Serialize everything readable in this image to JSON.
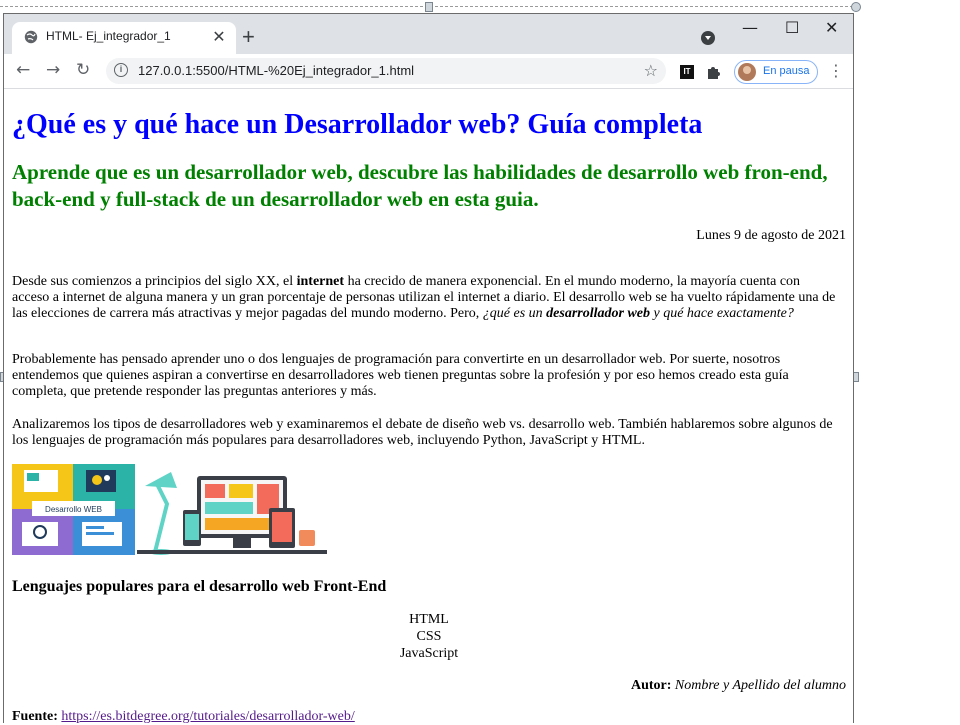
{
  "browser": {
    "tab_title": "HTML- Ej_integrador_1",
    "url": "127.0.0.1:5500/HTML-%20Ej_integrador_1.html",
    "profile_label": "En pausa"
  },
  "page": {
    "title": "¿Qué es y qué hace un Desarrollador web? Guía completa",
    "subtitle": "Aprende que es un desarrollador web, descubre las habilidades de desarrollo web fron-end, back-end y full-stack de un desarrollador web en esta guia.",
    "date": "Lunes 9 de agosto de 2021",
    "p1": {
      "t1": "Desde sus comienzos a principios del siglo XX, el ",
      "b1": "internet",
      "t2": " ha crecido de manera exponencial. En el mundo moderno, la mayoría cuenta con acceso a internet de alguna manera y un gran porcentaje de personas utilizan el internet a diario. El desarrollo web se ha vuelto rápidamente una de las elecciones de carrera más atractivas y mejor pagadas del mundo moderno. Pero, ",
      "i1": "¿qué es un ",
      "ib": "desarrollador web",
      "i2": " y qué hace exactamente?"
    },
    "p2": "Probablemente has pensado aprender uno o dos lenguajes de programación para convertirte en un desarrollador web. Por suerte, nosotros entendemos que quienes aspiran a convertirse en desarrolladores web tienen preguntas sobre la profesión y por eso hemos creado esta guía completa, que pretende responder las preguntas anteriores y más.",
    "p3": "Analizaremos los tipos de desarrolladores web y examinaremos el debate de diseño web vs. desarrollo web. También hablaremos sobre algunos de los lenguajes de programación más populares para desarrolladores web, incluyendo Python, JavaScript y HTML.",
    "image1_label": "Desarrollo WEB",
    "section_heading": "Lenguajes populares para el desarrollo web Front-End",
    "languages": [
      "HTML",
      "CSS",
      "JavaScript"
    ],
    "author_label": "Autor:",
    "author_name": "Nombre y Apellido del alumno",
    "source_label": "Fuente:",
    "source_link": "https://es.bitdegree.org/tutoriales/desarrollador-web/"
  }
}
